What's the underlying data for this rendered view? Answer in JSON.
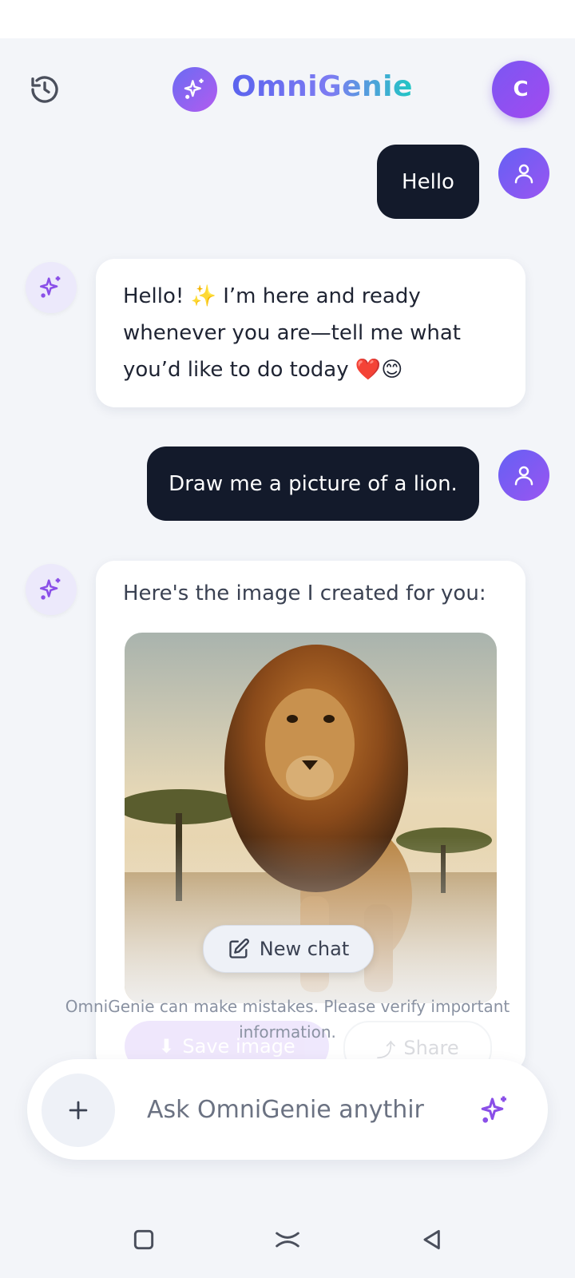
{
  "app": {
    "title": "OmniGenie",
    "profile_initial": "C"
  },
  "icons": {
    "history": "history-icon",
    "logo": "sparkle-icon",
    "user_avatar": "user-icon",
    "ai_avatar": "sparkle-icon",
    "new_chat": "edit-icon",
    "save": "download-icon",
    "share": "share-icon",
    "plus": "plus-icon",
    "send": "sparkle-icon"
  },
  "colors": {
    "accent": "#7b57f2",
    "user_bubble": "#131a2b",
    "background": "#f3f5f9"
  },
  "messages": [
    {
      "role": "user",
      "text": "Hello"
    },
    {
      "role": "assistant",
      "lines": [
        "Hello! ✨ I’m here and ready",
        "whenever you are—tell me what",
        "you’d like to do today ❤️😊"
      ]
    },
    {
      "role": "user",
      "text": "Draw me a picture of a lion."
    },
    {
      "role": "assistant",
      "text": "Here's the image I created for you:",
      "image_alt": "lion"
    }
  ],
  "image_actions": {
    "save_label": "Save image",
    "share_label": "Share"
  },
  "new_chat_label": "New chat",
  "disclaimer": "OmniGenie can make mistakes. Please verify important information.",
  "composer": {
    "placeholder": "Ask OmniGenie anythir"
  },
  "navbar": {
    "items": [
      "recents",
      "home",
      "back"
    ]
  }
}
